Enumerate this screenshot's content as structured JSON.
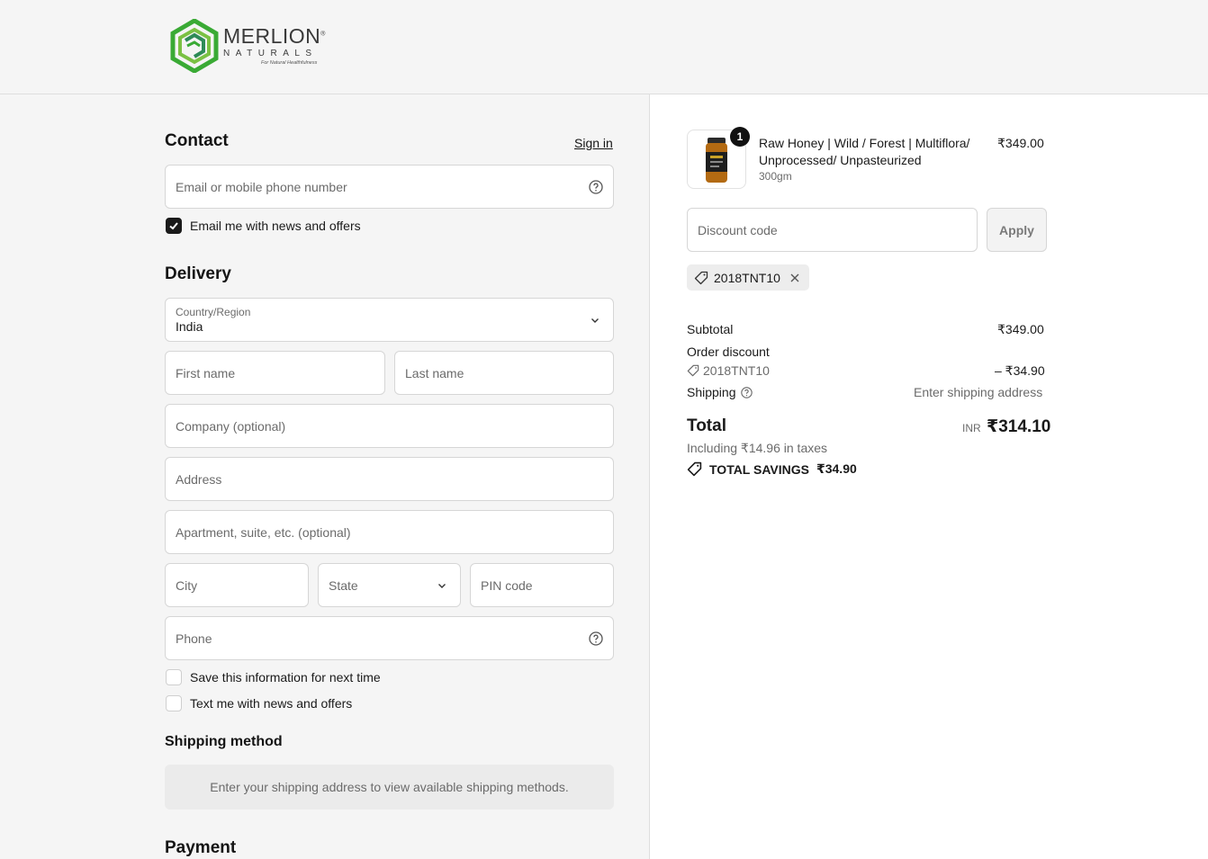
{
  "brand": {
    "name": "MERLION",
    "sub": "NATURALS",
    "tagline": "For Natural Healthfulness",
    "reg": "®"
  },
  "contact": {
    "title": "Contact",
    "sign_in": "Sign in",
    "email_placeholder": "Email or mobile phone number",
    "news_label": "Email me with news and offers",
    "news_checked": true
  },
  "delivery": {
    "title": "Delivery",
    "country_label": "Country/Region",
    "country_value": "India",
    "first_name": "First name",
    "last_name": "Last name",
    "company": "Company (optional)",
    "address": "Address",
    "apartment": "Apartment, suite, etc. (optional)",
    "city": "City",
    "state": "State",
    "pin": "PIN code",
    "phone": "Phone",
    "save_info": "Save this information for next time",
    "text_me": "Text me with news and offers"
  },
  "shipping": {
    "title": "Shipping method",
    "notice": "Enter your shipping address to view available shipping methods."
  },
  "payment": {
    "title": "Payment"
  },
  "order": {
    "item": {
      "qty": "1",
      "name_line1": "Raw Honey | Wild / Forest | Multiflora/",
      "name_line2": "Unprocessed/ Unpasteurized",
      "variant": "300gm",
      "price": "₹349.00"
    },
    "discount_placeholder": "Discount code",
    "apply_label": "Apply",
    "applied_code": "2018TNT10",
    "subtotal_label": "Subtotal",
    "subtotal_value": "₹349.00",
    "order_discount_label": "Order discount",
    "discount_code": "2018TNT10",
    "discount_value": "– ₹34.90",
    "shipping_label": "Shipping",
    "shipping_value": "Enter shipping address",
    "total_label": "Total",
    "currency": "INR",
    "total_value": "₹314.10",
    "taxes": "Including ₹14.96 in taxes",
    "savings_label": "TOTAL SAVINGS",
    "savings_value": "₹34.90"
  }
}
